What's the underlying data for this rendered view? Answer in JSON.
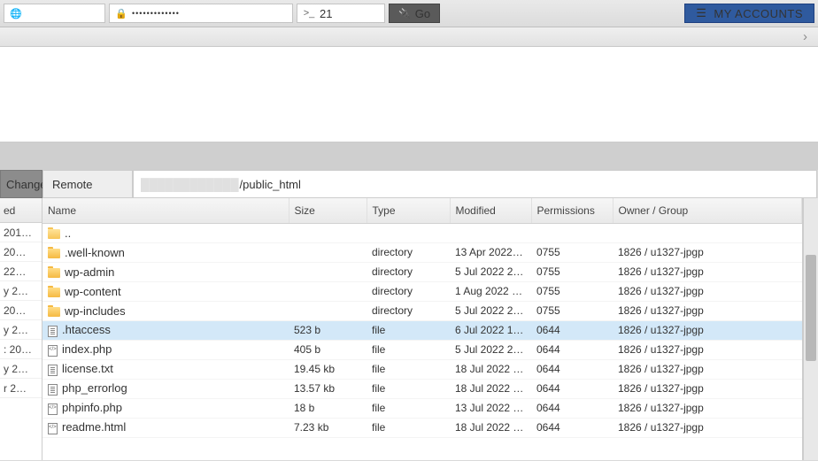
{
  "topbar": {
    "host_value": "",
    "password_mask": "•••••••••••••",
    "port_prefix": ">_",
    "port_value": "21",
    "go_label": "Go",
    "accounts_label": "MY ACCOUNTS"
  },
  "panel": {
    "change_label": "Change",
    "remote_label": "Remote",
    "path_suffix": "/public_html"
  },
  "left": {
    "header": "ed",
    "rows": [
      " 201…",
      " 20…",
      "22…",
      "y 2…",
      " 20…",
      "y 2…",
      ": 20…",
      "y 2…",
      "r 2…"
    ]
  },
  "columns": {
    "name": "Name",
    "size": "Size",
    "type": "Type",
    "modified": "Modified",
    "permissions": "Permissions",
    "owner": "Owner / Group"
  },
  "files": [
    {
      "icon": "folderopen",
      "name": "..",
      "size": "",
      "type": "",
      "modified": "",
      "perm": "",
      "owner": "",
      "sel": false
    },
    {
      "icon": "folder",
      "name": ".well-known",
      "size": "",
      "type": "directory",
      "modified": "13 Apr 2022 …",
      "perm": "0755",
      "owner": "1826 / u1327-jpgp",
      "sel": false
    },
    {
      "icon": "folder",
      "name": "wp-admin",
      "size": "",
      "type": "directory",
      "modified": "5 Jul 2022 22:…",
      "perm": "0755",
      "owner": "1826 / u1327-jpgp",
      "sel": false
    },
    {
      "icon": "folder",
      "name": "wp-content",
      "size": "",
      "type": "directory",
      "modified": "1 Aug 2022 1…",
      "perm": "0755",
      "owner": "1826 / u1327-jpgp",
      "sel": false
    },
    {
      "icon": "folder",
      "name": "wp-includes",
      "size": "",
      "type": "directory",
      "modified": "5 Jul 2022 22:…",
      "perm": "0755",
      "owner": "1826 / u1327-jpgp",
      "sel": false
    },
    {
      "icon": "file",
      "name": ".htaccess",
      "size": "523 b",
      "type": "file",
      "modified": "6 Jul 2022 16:…",
      "perm": "0644",
      "owner": "1826 / u1327-jpgp",
      "sel": true
    },
    {
      "icon": "code",
      "name": "index.php",
      "size": "405 b",
      "type": "file",
      "modified": "5 Jul 2022 22:…",
      "perm": "0644",
      "owner": "1826 / u1327-jpgp",
      "sel": false
    },
    {
      "icon": "file",
      "name": "license.txt",
      "size": "19.45 kb",
      "type": "file",
      "modified": "18 Jul 2022 2…",
      "perm": "0644",
      "owner": "1826 / u1327-jpgp",
      "sel": false
    },
    {
      "icon": "file",
      "name": "php_errorlog",
      "size": "13.57 kb",
      "type": "file",
      "modified": "18 Jul 2022 2…",
      "perm": "0644",
      "owner": "1826 / u1327-jpgp",
      "sel": false
    },
    {
      "icon": "code",
      "name": "phpinfo.php",
      "size": "18 b",
      "type": "file",
      "modified": "13 Jul 2022 1…",
      "perm": "0644",
      "owner": "1826 / u1327-jpgp",
      "sel": false
    },
    {
      "icon": "code",
      "name": "readme.html",
      "size": "7.23 kb",
      "type": "file",
      "modified": "18 Jul 2022 2…",
      "perm": "0644",
      "owner": "1826 / u1327-jpgp",
      "sel": false
    }
  ]
}
